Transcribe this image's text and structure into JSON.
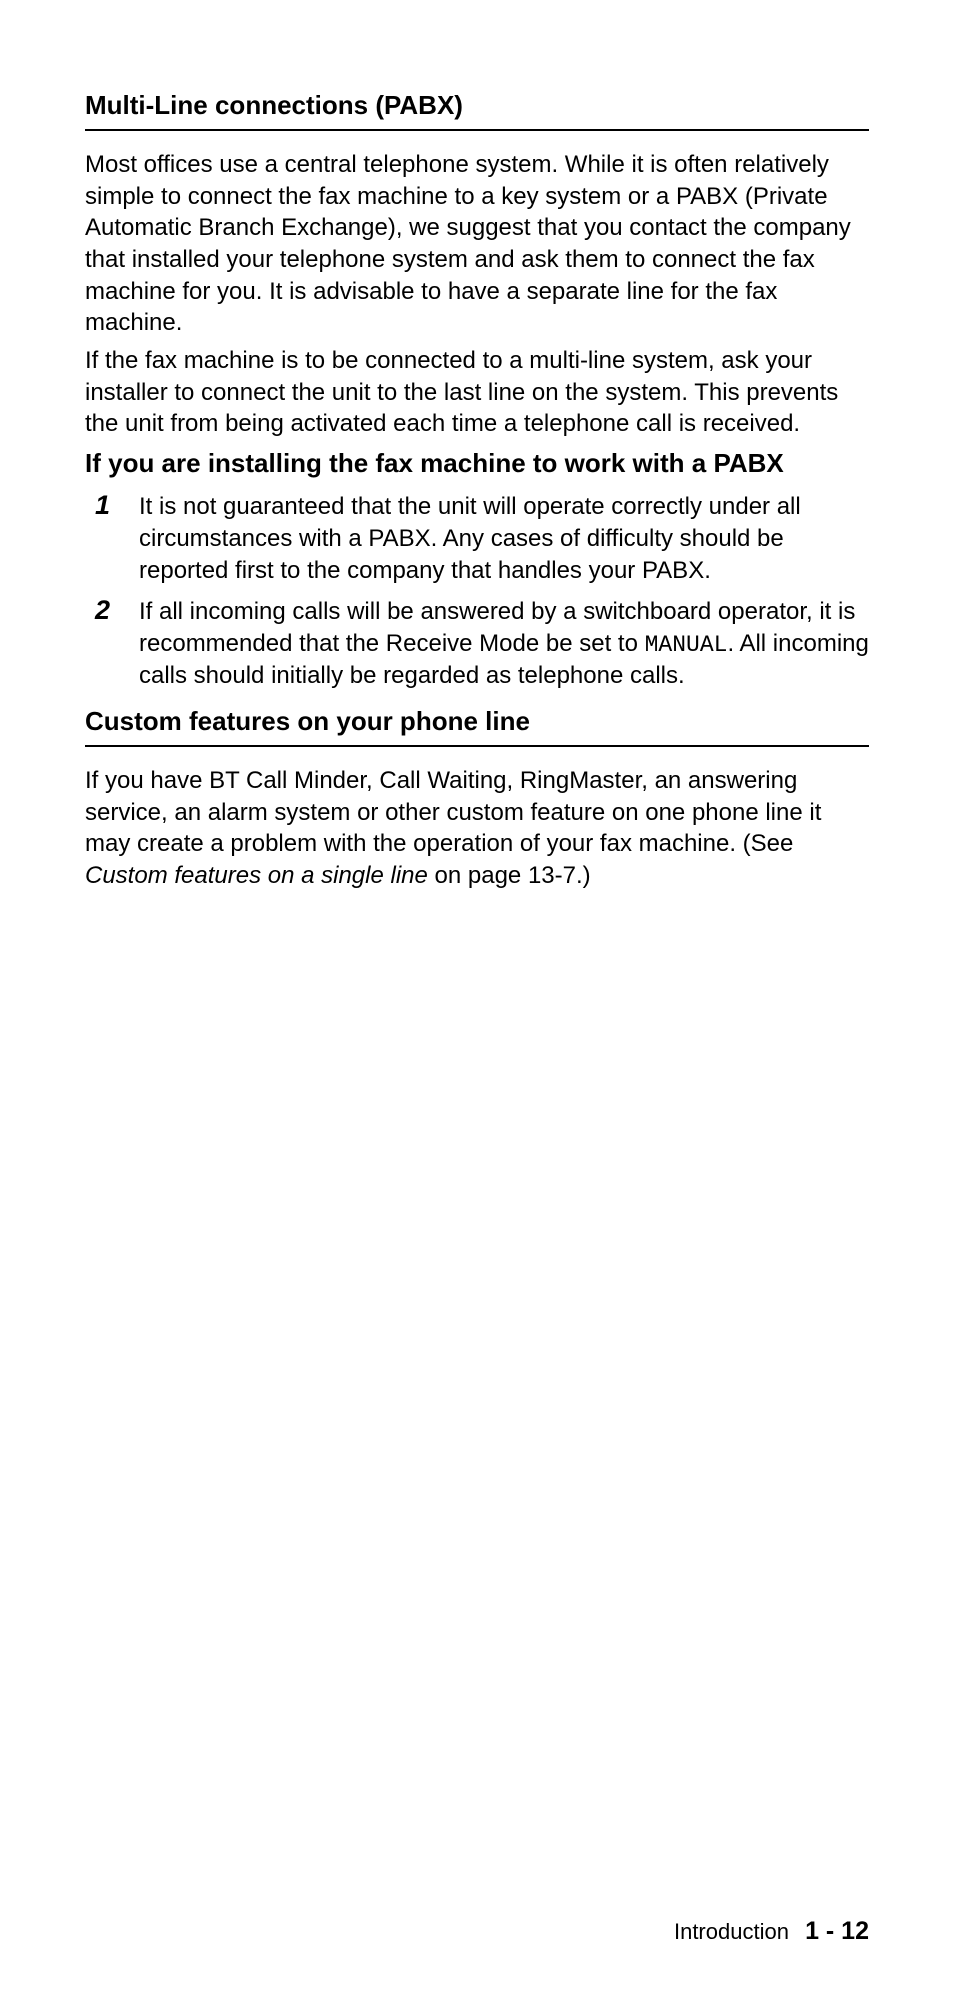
{
  "section1": {
    "heading": "Multi-Line connections (PABX)",
    "para1": "Most offices use a central telephone system. While it is often relatively simple to connect the fax machine to a key system or a PABX (Private Automatic Branch Exchange), we suggest that you contact the company that installed your telephone system and ask them to connect the fax machine for you. It is advisable to have a separate line for the fax machine.",
    "para2": "If the fax machine is to be connected to a multi-line system, ask your installer to connect the unit to the last line on the system. This prevents the unit from being activated each time a telephone call is received.",
    "subheading": "If you are installing the fax machine to work with a PABX",
    "list": [
      {
        "num": "1",
        "text": "It is not guaranteed that the unit will operate correctly under all circumstances with a PABX. Any cases of difficulty should be reported first to the company that handles your PABX."
      },
      {
        "num": "2",
        "pre": "If all incoming calls will be answered by a switchboard operator, it is recommended that the Receive Mode be set to ",
        "mono": "MANUAL",
        "post": ". All incoming calls should initially be regarded as telephone calls."
      }
    ]
  },
  "section2": {
    "heading": "Custom features on your phone line",
    "para_pre": "If you have BT Call Minder, Call Waiting, RingMaster, an answering service, an alarm system or other custom feature on one phone line it may create a problem with the operation of your fax machine. (See ",
    "para_italic": "Custom features on a single line",
    "para_post": " on page 13-7.)"
  },
  "footer": {
    "label": "Introduction",
    "page": "1 - 12"
  }
}
